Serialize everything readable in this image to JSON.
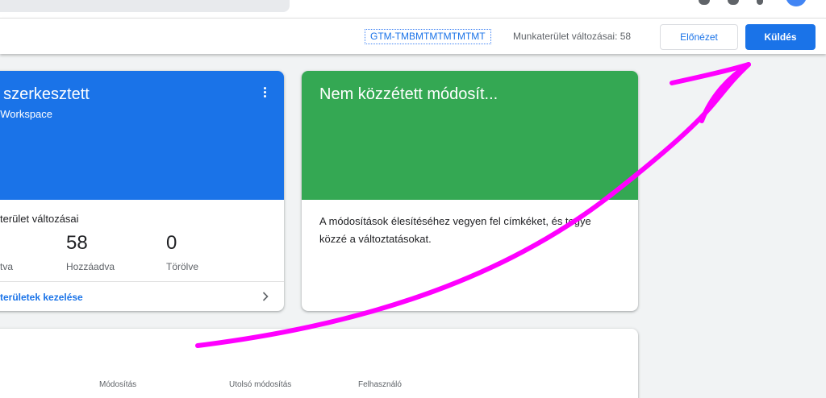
{
  "toolbar": {
    "container_id": "GTM-TMBMTMTMTMTMT",
    "workspace_changes": "Munkaterület változásai: 58",
    "preview_label": "Előnézet",
    "submit_label": "Küldés"
  },
  "workspace_card": {
    "title": "t szerkesztett",
    "subtitle": "t Workspace",
    "changes_label": "terület változásai",
    "stats": [
      {
        "value": "",
        "label": "tva"
      },
      {
        "value": "58",
        "label": "Hozzáadva"
      },
      {
        "value": "0",
        "label": "Törölve"
      }
    ],
    "manage_link": "területek kezelése"
  },
  "unpublished_card": {
    "title": "Nem közzétett módosít...",
    "description": "A módosítások élesítéséhez vegyen fel címkéket, és tegye közzé a változtatásokat."
  },
  "table": {
    "columns": [
      "Módosítás",
      "Utolsó módosítás",
      "Felhasználó"
    ]
  },
  "colors": {
    "accent": "#1a73e8",
    "workspace_header": "#1a73e8",
    "unpublished_header": "#34a853",
    "annotation_arrow": "#ff00ff"
  },
  "icons": [
    "kebab-menu-icon",
    "chevron-right-icon",
    "user-avatar"
  ]
}
